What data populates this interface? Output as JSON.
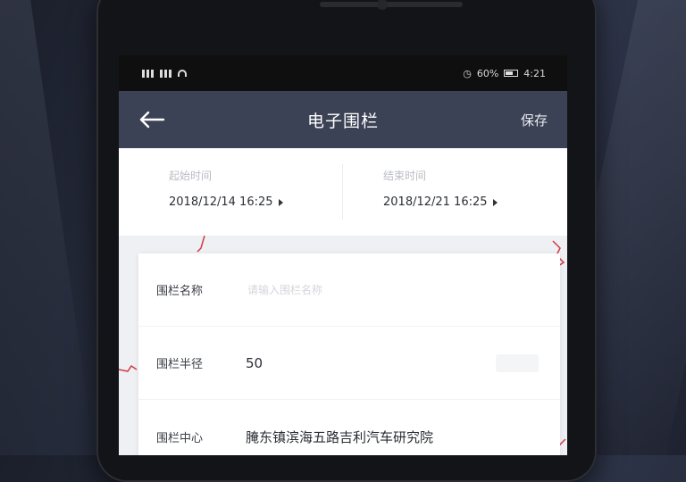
{
  "status_bar": {
    "battery_percent": "60%",
    "time": "4:21"
  },
  "header": {
    "title": "电子围栏",
    "save_label": "保存"
  },
  "time_range": {
    "start_label": "起始时间",
    "start_value": "2018/12/14 16:25",
    "end_label": "结束时间",
    "end_value": "2018/12/21 16:25"
  },
  "form": {
    "name_label": "围栏名称",
    "name_placeholder": "请输入围栏名称",
    "radius_label": "围栏半径",
    "radius_value": "50",
    "center_label": "围栏中心",
    "center_value": "腌东镇滨海五路吉利汽车研究院"
  },
  "colors": {
    "navbar": "#3b4255",
    "route": "#d23a48"
  }
}
